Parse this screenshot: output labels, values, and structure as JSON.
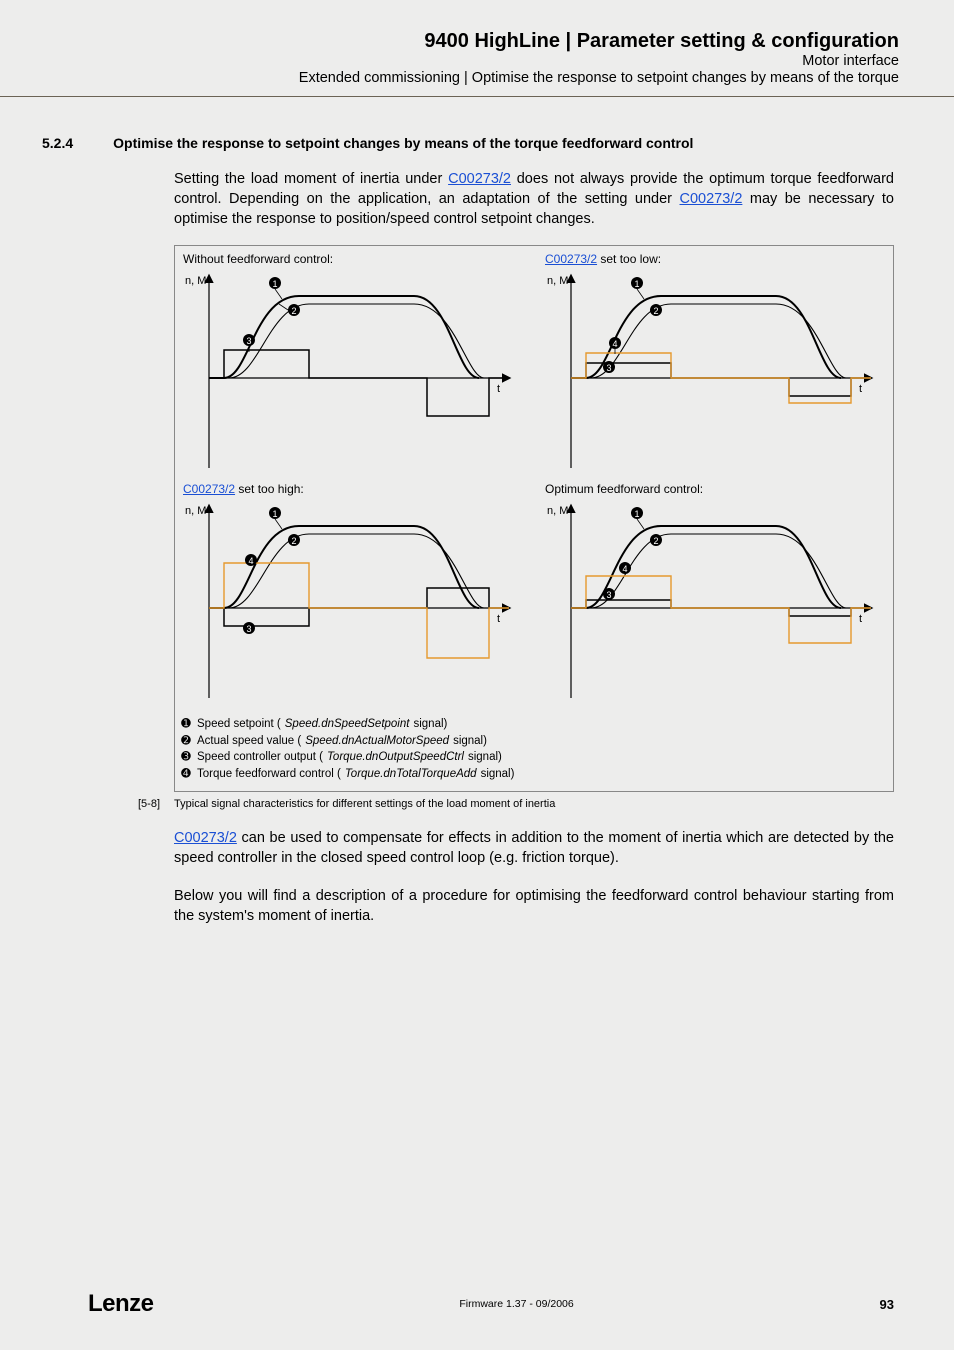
{
  "header": {
    "title": "9400 HighLine | Parameter setting & configuration",
    "sub1": "Motor interface",
    "sub2": "Extended commissioning | Optimise the response to setpoint changes by means of the torque"
  },
  "section": {
    "num": "5.2.4",
    "title": "Optimise the response to setpoint changes by means of the torque feedforward control"
  },
  "para1": {
    "t1": "Setting the load moment of inertia under ",
    "link1": "C00273/2",
    "t2": " does not always provide the optimum torque feedforward control. Depending on the application, an adaptation of the setting under ",
    "link2": "C00273/2",
    "t3": " may be necessary to optimise the response to position/speed control setpoint changes."
  },
  "graphs": {
    "a_label": "Without feedforward control:",
    "b_label_pre": "",
    "b_link": "C00273/2",
    "b_label_post": " set too low:",
    "c_link": "C00273/2",
    "c_label_post": " set too high:",
    "d_label": "Optimum feedforward control:",
    "axis_y": "n, M",
    "axis_x": "t"
  },
  "legend": {
    "l1_pre": "Speed setpoint (",
    "l1_sig": "Speed.dnSpeedSetpoint",
    "l1_post": " signal)",
    "l2_pre": "Actual speed value (",
    "l2_sig": "Speed.dnActualMotorSpeed",
    "l2_post": " signal)",
    "l3_pre": "Speed controller output (",
    "l3_sig": "Torque.dnOutputSpeedCtrl",
    "l3_post": " signal)",
    "l4_pre": "Torque feedforward control (",
    "l4_sig": "Torque.dnTotalTorqueAdd",
    "l4_post": " signal)"
  },
  "figlabel": {
    "num": "[5-8]",
    "desc": "Typical signal characteristics for different settings of the load moment of inertia"
  },
  "para2": {
    "link": "C00273/2",
    "t": " can be used to compensate for effects in addition to the moment of inertia which are detected by the speed controller in the closed speed control loop (e.g. friction torque)."
  },
  "para3": "Below you will find a description of a procedure for optimising the feedforward control behaviour starting from the system's moment of inertia.",
  "footer": {
    "logo": "Lenze",
    "center": "Firmware 1.37 - 09/2006",
    "page": "93"
  },
  "chart_data": {
    "type": "line",
    "note": "Four qualitative signal-response diagrams; axes are n,M vs t with no numeric ticks. Curves are qualitative shapes only.",
    "panels": [
      {
        "id": "A",
        "title": "Without feedforward control",
        "series": [
          "speed_setpoint",
          "actual_speed",
          "speed_ctrl_output"
        ],
        "feedforward_present": false
      },
      {
        "id": "B",
        "title": "C00273/2 set too low",
        "series": [
          "speed_setpoint",
          "actual_speed",
          "speed_ctrl_output",
          "torque_feedforward"
        ],
        "feedforward_present": true,
        "feedforward_level": "too_low"
      },
      {
        "id": "C",
        "title": "C00273/2 set too high",
        "series": [
          "speed_setpoint",
          "actual_speed",
          "speed_ctrl_output",
          "torque_feedforward"
        ],
        "feedforward_present": true,
        "feedforward_level": "too_high"
      },
      {
        "id": "D",
        "title": "Optimum feedforward control",
        "series": [
          "speed_setpoint",
          "actual_speed",
          "speed_ctrl_output",
          "torque_feedforward"
        ],
        "feedforward_present": true,
        "feedforward_level": "optimum"
      }
    ],
    "series_legend": {
      "1": "Speed setpoint (Speed.dnSpeedSetpoint)",
      "2": "Actual speed value (Speed.dnActualMotorSpeed)",
      "3": "Speed controller output (Torque.dnOutputSpeedCtrl)",
      "4": "Torque feedforward control (Torque.dnTotalTorqueAdd)"
    },
    "xlabel": "t",
    "ylabel": "n, M"
  }
}
